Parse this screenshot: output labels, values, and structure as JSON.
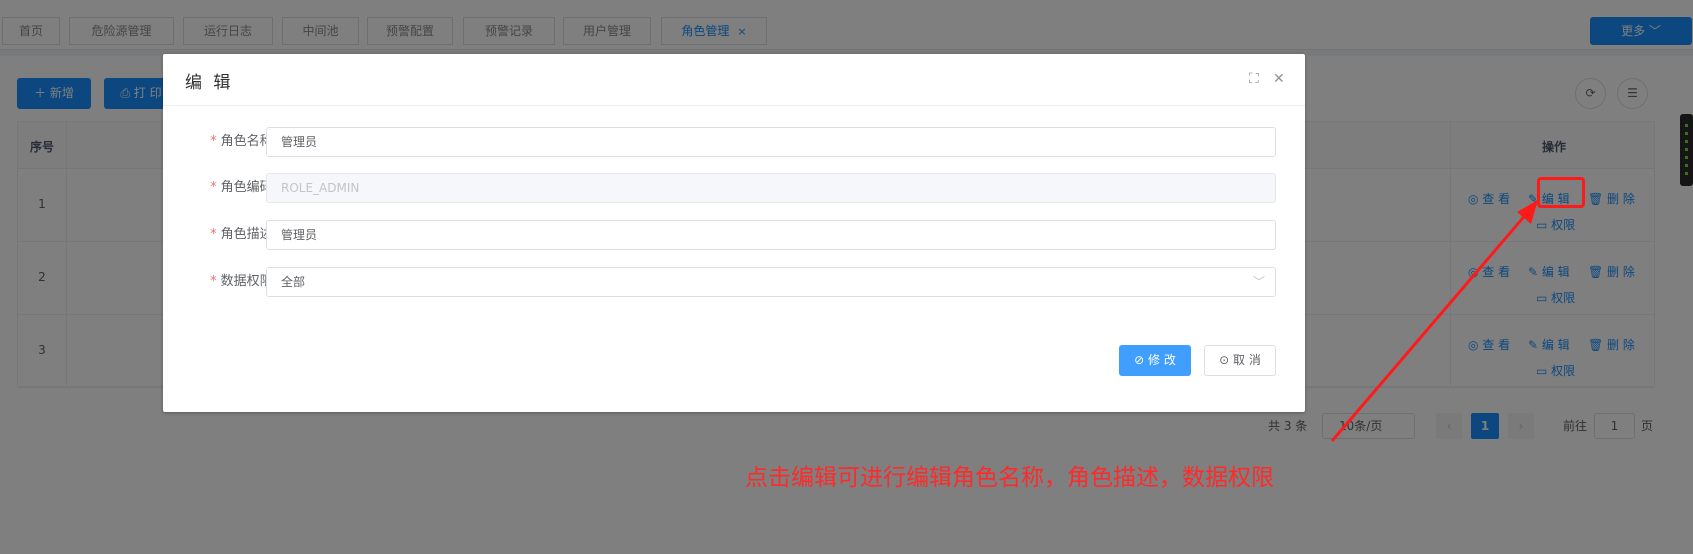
{
  "tabs": [
    "首页",
    "危险源管理",
    "运行日志",
    "中间池",
    "预警配置",
    "预警记录",
    "用户管理",
    "角色管理"
  ],
  "active_tab_close": "×",
  "more_button": "更多 ﹀",
  "toolbar": {
    "add_label": "＋ 新增",
    "print_label": "⎙ 打 印"
  },
  "table": {
    "headers": {
      "index": "序号",
      "actions": "操作"
    },
    "rows": [
      {
        "index": "1"
      },
      {
        "index": "2"
      },
      {
        "index": "3"
      }
    ],
    "actions": {
      "view": "◎ 查 看",
      "edit": "✎ 编 辑",
      "delete": "🗑 删 除",
      "permission": "▭ 权限"
    }
  },
  "pagination": {
    "total": "共 3 条",
    "page_size": "10条/页",
    "prev": "‹",
    "page": "1",
    "next": "›",
    "goto": "前往",
    "goto_value": "1",
    "page_unit": "页"
  },
  "dialog": {
    "title": "编 辑",
    "fullscreen_icon": "⛶",
    "close_icon": "✕",
    "fields": [
      {
        "label": "角色名称:",
        "value": "管理员"
      },
      {
        "label": "角色编码:",
        "value": "ROLE_ADMIN"
      },
      {
        "label": "角色描述:",
        "value": "管理员"
      },
      {
        "label": "数据权限:",
        "value": "全部"
      }
    ],
    "required_mark": "*",
    "select_arrow": "﹀",
    "submit_label": "⊘ 修 改",
    "cancel_label": "⊙ 取 消"
  },
  "annotation": "点击编辑可进行编辑角色名称，角色描述，数据权限",
  "colors": {
    "primary": "#1890ff",
    "annotation": "#ff2a2a",
    "required": "#f56c6c"
  }
}
